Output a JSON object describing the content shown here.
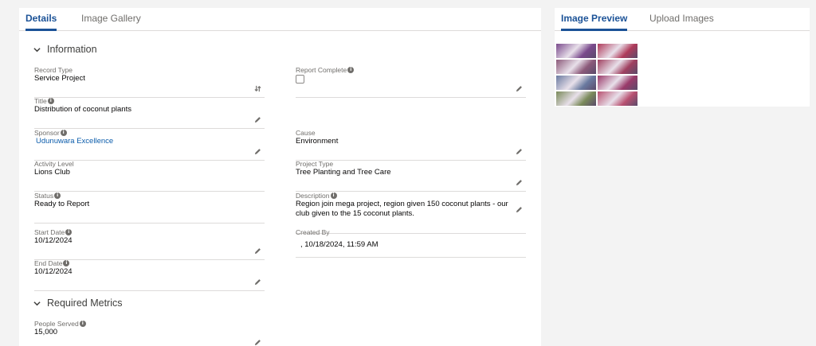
{
  "left_panel": {
    "tabs": [
      {
        "label": "Details"
      },
      {
        "label": "Image Gallery"
      }
    ],
    "information": {
      "title": "Information",
      "fields": {
        "record_type": {
          "label": "Record Type",
          "value": "Service Project"
        },
        "report_complete": {
          "label": "Report Complete",
          "checked": false
        },
        "title": {
          "label": "Title",
          "value": "Distribution of coconut plants"
        },
        "sponsor": {
          "label": "Sponsor",
          "value": "Udunuwara Excellence"
        },
        "cause": {
          "label": "Cause",
          "value": "Environment"
        },
        "activity_level": {
          "label": "Activity Level",
          "value": "Lions Club"
        },
        "project_type": {
          "label": "Project Type",
          "value": "Tree Planting and Tree Care"
        },
        "status": {
          "label": "Status",
          "value": "Ready to Report"
        },
        "description": {
          "label": "Description",
          "value": "Region join mega project, region given 150 coconut plants - our club given to the 15 coconut plants."
        },
        "start_date": {
          "label": "Start Date",
          "value": "10/12/2024"
        },
        "created_by": {
          "label": "Created By",
          "value": ", 10/18/2024, 11:59 AM"
        },
        "end_date": {
          "label": "End Date",
          "value": "10/12/2024"
        }
      }
    },
    "required_metrics": {
      "title": "Required Metrics",
      "fields": {
        "people_served": {
          "label": "People Served",
          "value": "15,000"
        }
      }
    }
  },
  "right_panel": {
    "tabs": [
      {
        "label": "Image Preview"
      },
      {
        "label": "Upload Images"
      }
    ],
    "thumbnail_colors": [
      "#7a4a8c",
      "#b03a5a",
      "#8c5a7a",
      "#a04060",
      "#6a7aa0",
      "#9a3a6a",
      "#7a8a5a",
      "#b85070"
    ]
  },
  "colors": {
    "accent": "#1b5297",
    "link": "#0b5cab",
    "label": "#706e6b",
    "divider": "#dddbda"
  },
  "icons": {
    "edit": "pencil-icon",
    "record_type": "swap-icon",
    "info": "info-icon",
    "section": "chevron-down-icon"
  }
}
